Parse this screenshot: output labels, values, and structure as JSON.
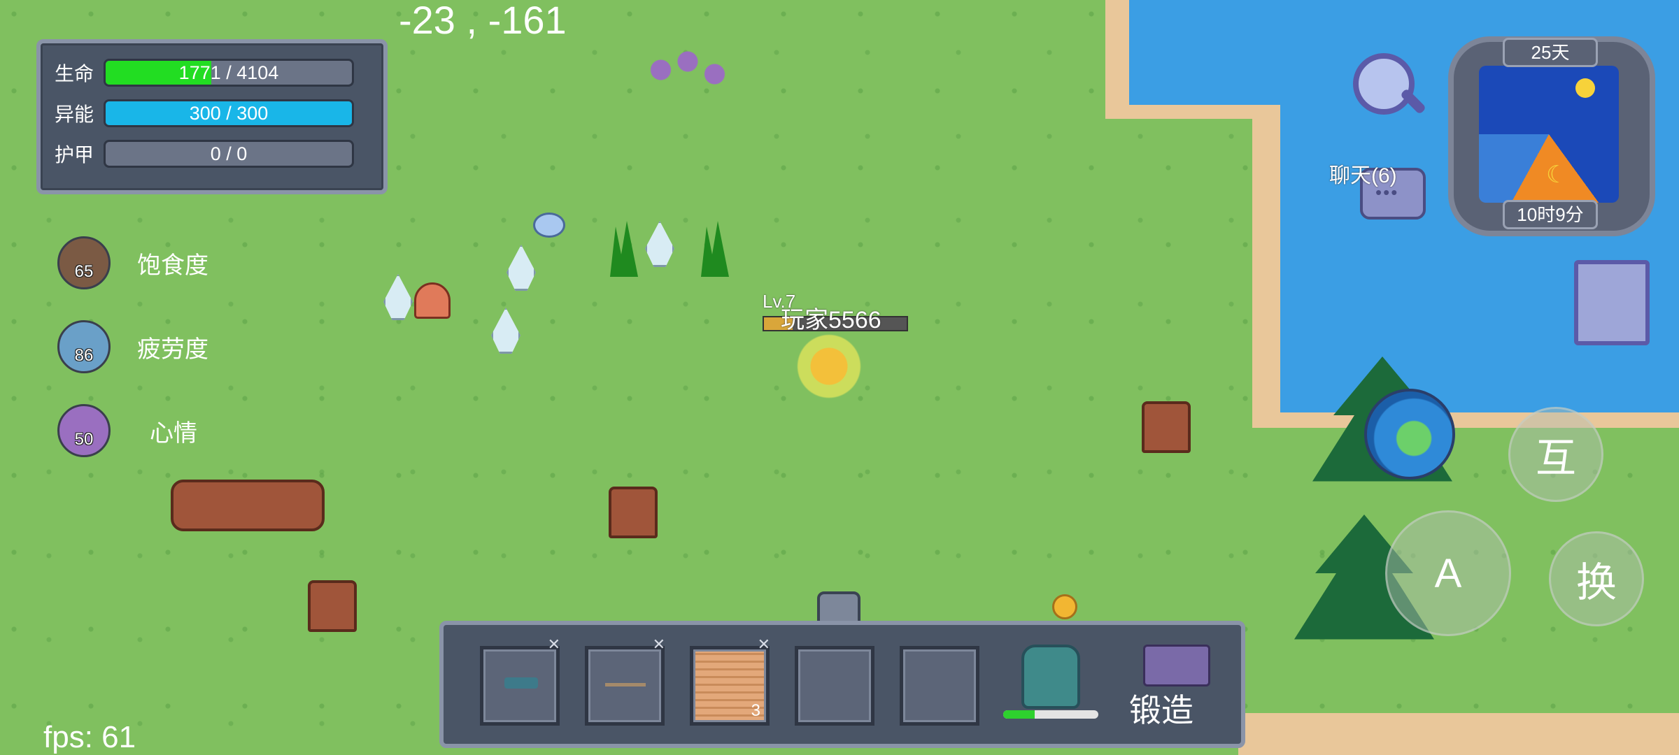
{
  "coords": "-23 , -161",
  "fps": "fps: 61",
  "stats": [
    {
      "label": "生命",
      "text": "1771 / 4104",
      "fraction": 0.43,
      "color": "#22dd22"
    },
    {
      "label": "异能",
      "text": "300 / 300",
      "fraction": 1.0,
      "color": "#19b6e8"
    },
    {
      "label": "护甲",
      "text": "0 / 0",
      "fraction": 0,
      "color": "#888888"
    }
  ],
  "needs": [
    {
      "label": "饱食度",
      "value": "65",
      "color": "#7b5a44"
    },
    {
      "label": "疲劳度",
      "value": "86",
      "color": "#6aa0c8"
    },
    {
      "label": "心情",
      "value": "50",
      "color": "#9a6fc0"
    }
  ],
  "clock": {
    "day": "25天",
    "time": "10时9分"
  },
  "chat": {
    "label": "聊天(6)"
  },
  "buttons": {
    "interact": "互",
    "attack": "A",
    "switch": "换"
  },
  "player": {
    "level": "Lv.7",
    "name": "玩家5566"
  },
  "hotbar": {
    "slots": [
      {
        "item": "crossbow",
        "count": ""
      },
      {
        "item": "spear",
        "count": ""
      },
      {
        "item": "wood-planks",
        "count": "3"
      },
      {
        "item": "empty",
        "count": ""
      },
      {
        "item": "empty",
        "count": ""
      }
    ],
    "bag_fill": 0.33,
    "forge_label": "锻造"
  }
}
